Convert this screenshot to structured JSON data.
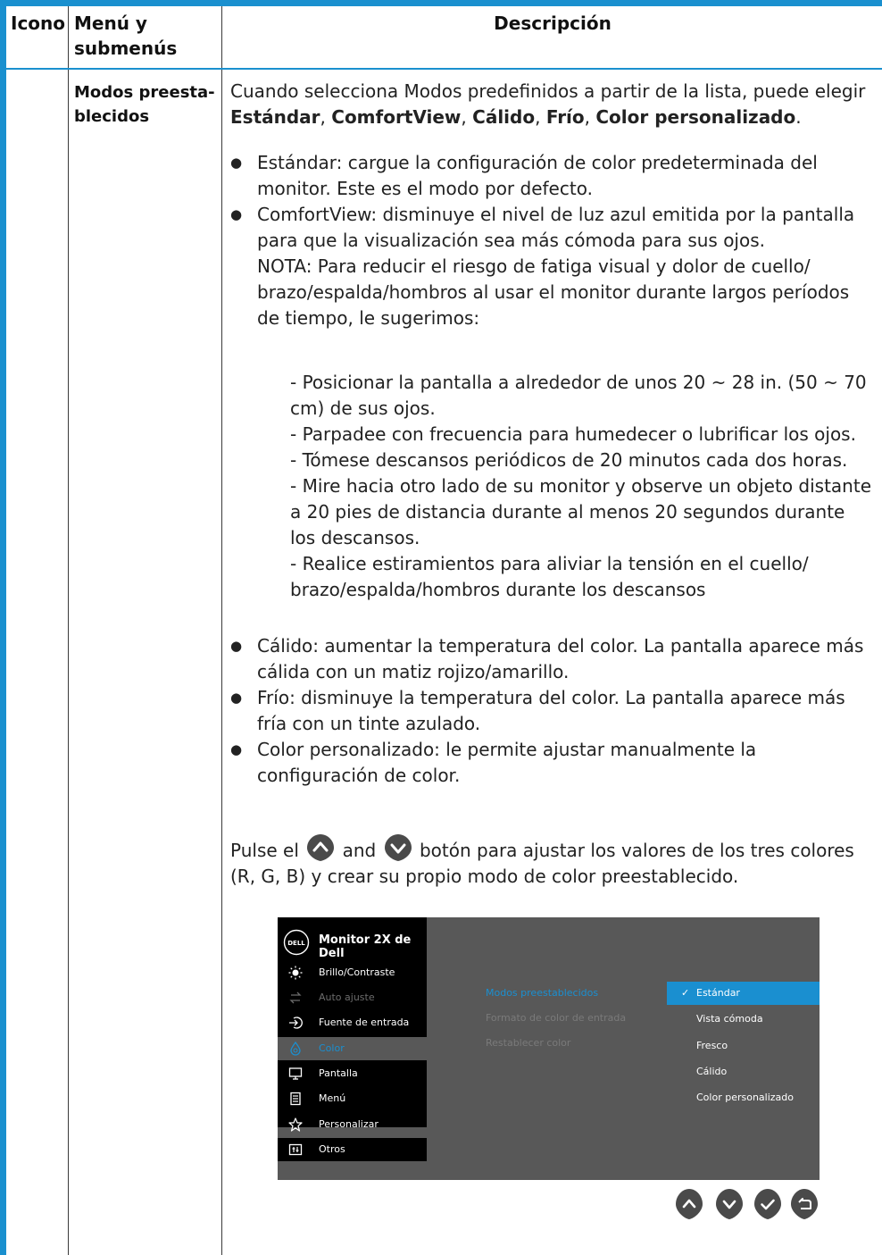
{
  "header": {
    "icon": "Icono",
    "menu": "Menú y submenús",
    "description": "Descripción"
  },
  "row": {
    "menu_name": "Modos preesta-blecidos",
    "intro_1": "Cuando selecciona Modos predefinidos a partir de la lista, puede elegir ",
    "opt_standard": "Estándar",
    "sep": ", ",
    "opt_comfort": "ComfortView",
    "opt_warm": "Cálido",
    "opt_cool": "Frío",
    "opt_custom": "Color personalizado",
    "end": ".",
    "bullet_standard": "Estándar: cargue la configuración de color predeterminada del monitor. Este es el modo por defecto.",
    "bullet_comfort": "ComfortView: disminuye el nivel de luz azul emitida por la pantalla para que la visualización sea más cómoda para sus ojos.",
    "note_intro": "NOTA: Para reducir el riesgo de fatiga visual y dolor de cuello/ brazo/espalda/hombros al usar el monitor durante largos períodos de tiempo, le sugerimos:",
    "tips": [
      "- Posicionar la pantalla a alrededor de unos 20 ~ 28 in. (50 ~ 70 cm) de sus ojos.",
      "- Parpadee con frecuencia para humedecer o lubrificar los ojos.",
      "- Tómese descansos periódicos de 20 minutos cada dos horas.",
      "- Mire hacia otro lado de su monitor y observe un objeto distante a 20 pies de distancia durante al menos 20 segundos durante los descansos.",
      "- Realice estiramientos para aliviar la tensión en el cuello/ brazo/espalda/hombros durante los descansos"
    ],
    "bullet_warm": "Cálido: aumentar la temperatura del color. La pantalla aparece más cálida con un matiz rojizo/amarillo.",
    "bullet_cool": "Frío: disminuye la temperatura del color. La pantalla aparece más fría con un tinte azulado.",
    "bullet_custom": "Color personalizado: le permite ajustar manualmente la configuración de color.",
    "press_1": "Pulse el ",
    "press_and": " and ",
    "press_2": " botón para ajustar los valores de los tres colores (R, G, B) y crear su propio modo de color preestablecido."
  },
  "osd": {
    "logo": "DELL",
    "title": "Monitor 2X de Dell",
    "menu": [
      {
        "label": "Brillo/Contraste",
        "icon": "brightness-icon",
        "state": "on"
      },
      {
        "label": "Auto ajuste",
        "icon": "auto-adjust-icon",
        "state": "off"
      },
      {
        "label": "Fuente de entrada",
        "icon": "input-source-icon",
        "state": "on"
      },
      {
        "label": "Color",
        "icon": "color-icon",
        "state": "sel"
      },
      {
        "label": "Pantalla",
        "icon": "display-icon",
        "state": "on"
      },
      {
        "label": "Menú",
        "icon": "menu-icon",
        "state": "on"
      },
      {
        "label": "Personalizar",
        "icon": "star-icon",
        "state": "on"
      },
      {
        "label": "Otros",
        "icon": "others-icon",
        "state": "on"
      }
    ],
    "submenu": [
      "Modos preestablecidos",
      "Formato de color de entrada",
      "Restablecer color"
    ],
    "options": [
      "Estándar",
      "Vista cómoda",
      "Fresco",
      "Cálido",
      "Color personalizado"
    ],
    "selected_option": "Estándar",
    "buttons": [
      "up-icon",
      "down-icon",
      "check-icon",
      "back-icon"
    ]
  },
  "colors": {
    "accent": "#1a90cf",
    "osd_bg": "#585858",
    "osd_selected": "#1a8fd0",
    "button": "#4a4a4a"
  }
}
